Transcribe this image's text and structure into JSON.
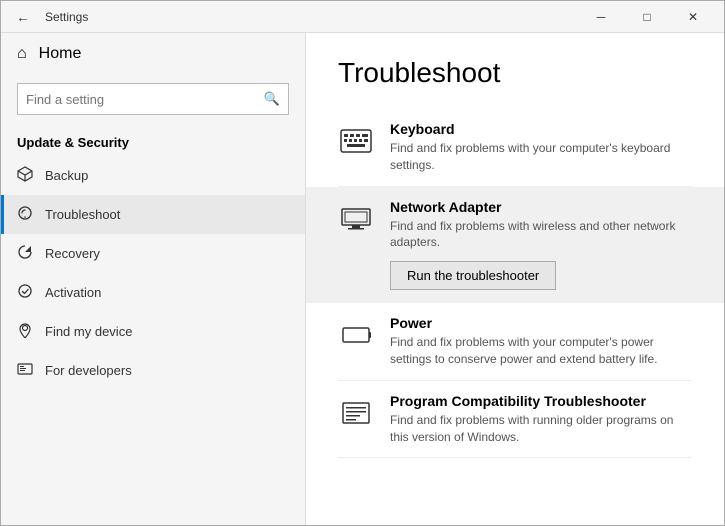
{
  "titlebar": {
    "title": "Settings",
    "min_label": "─",
    "max_label": "□",
    "close_label": "✕"
  },
  "sidebar": {
    "home_label": "Home",
    "search_placeholder": "Find a setting",
    "section_title": "Update & Security",
    "items": [
      {
        "id": "backup",
        "label": "Backup",
        "icon": "backup"
      },
      {
        "id": "troubleshoot",
        "label": "Troubleshoot",
        "icon": "troubleshoot",
        "active": true
      },
      {
        "id": "recovery",
        "label": "Recovery",
        "icon": "recovery"
      },
      {
        "id": "activation",
        "label": "Activation",
        "icon": "activation"
      },
      {
        "id": "find-my-device",
        "label": "Find my device",
        "icon": "find"
      },
      {
        "id": "for-developers",
        "label": "For developers",
        "icon": "developers"
      }
    ]
  },
  "main": {
    "title": "Troubleshoot",
    "items": [
      {
        "id": "keyboard",
        "title": "Keyboard",
        "description": "Find and fix problems with your computer's keyboard settings.",
        "highlighted": false
      },
      {
        "id": "network-adapter",
        "title": "Network Adapter",
        "description": "Find and fix problems with wireless and other network adapters.",
        "highlighted": true,
        "run_button": "Run the troubleshooter"
      },
      {
        "id": "power",
        "title": "Power",
        "description": "Find and fix problems with your computer's power settings to conserve power and extend battery life.",
        "highlighted": false
      },
      {
        "id": "program-compatibility",
        "title": "Program Compatibility Troubleshooter",
        "description": "Find and fix problems with running older programs on this version of Windows.",
        "highlighted": false
      }
    ]
  }
}
